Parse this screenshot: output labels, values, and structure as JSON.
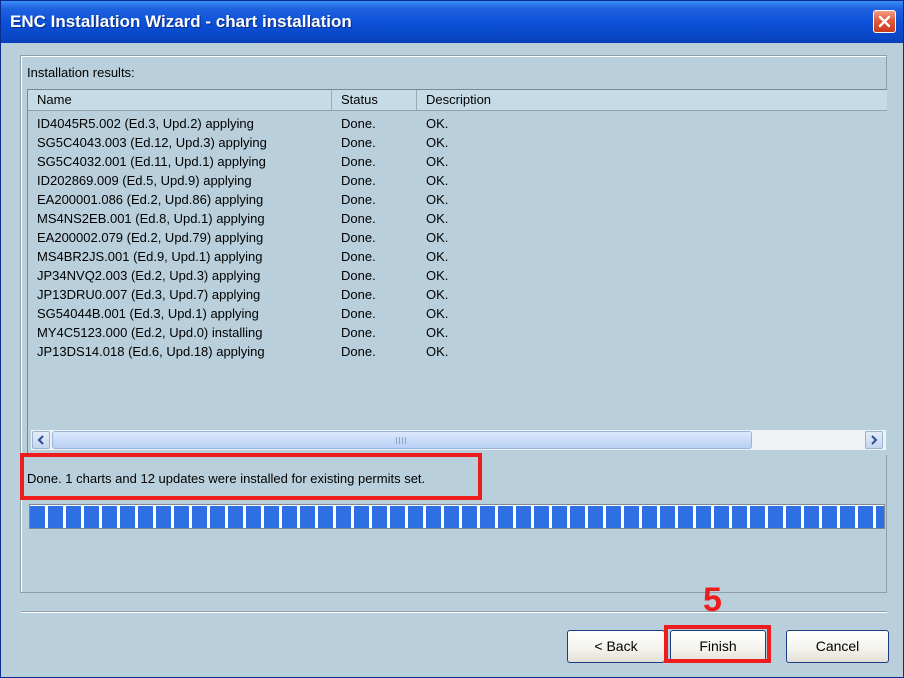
{
  "window": {
    "title": "ENC Installation Wizard - chart installation"
  },
  "group": {
    "label": "Installation results:"
  },
  "columns": {
    "name": "Name",
    "status": "Status",
    "description": "Description"
  },
  "rows": [
    {
      "name": "ID4045R5.002 (Ed.3, Upd.2) applying",
      "status": "Done.",
      "description": "OK."
    },
    {
      "name": "SG5C4043.003 (Ed.12, Upd.3) applying",
      "status": "Done.",
      "description": "OK."
    },
    {
      "name": "SG5C4032.001 (Ed.11, Upd.1) applying",
      "status": "Done.",
      "description": "OK."
    },
    {
      "name": "ID202869.009 (Ed.5, Upd.9) applying",
      "status": "Done.",
      "description": "OK."
    },
    {
      "name": "EA200001.086 (Ed.2, Upd.86) applying",
      "status": "Done.",
      "description": "OK."
    },
    {
      "name": "MS4NS2EB.001 (Ed.8, Upd.1) applying",
      "status": "Done.",
      "description": "OK."
    },
    {
      "name": "EA200002.079 (Ed.2, Upd.79) applying",
      "status": "Done.",
      "description": "OK."
    },
    {
      "name": "MS4BR2JS.001 (Ed.9, Upd.1) applying",
      "status": "Done.",
      "description": "OK."
    },
    {
      "name": "JP34NVQ2.003 (Ed.2, Upd.3) applying",
      "status": "Done.",
      "description": "OK."
    },
    {
      "name": "JP13DRU0.007 (Ed.3, Upd.7) applying",
      "status": "Done.",
      "description": "OK."
    },
    {
      "name": "SG54044B.001 (Ed.3, Upd.1) applying",
      "status": "Done.",
      "description": "OK."
    },
    {
      "name": "MY4C5123.000 (Ed.2, Upd.0) installing",
      "status": "Done.",
      "description": "OK."
    },
    {
      "name": "JP13DS14.018 (Ed.6, Upd.18) applying",
      "status": "Done.",
      "description": "OK."
    }
  ],
  "status_message": "Done.  1 charts and 12 updates were installed for existing permits set.",
  "progress": {
    "fraction": 1.0,
    "color": "#2f6fe4"
  },
  "buttons": {
    "back": "< Back",
    "finish": "Finish",
    "cancel": "Cancel"
  },
  "annotation": {
    "step": "5",
    "color": "#ee1c1c"
  }
}
